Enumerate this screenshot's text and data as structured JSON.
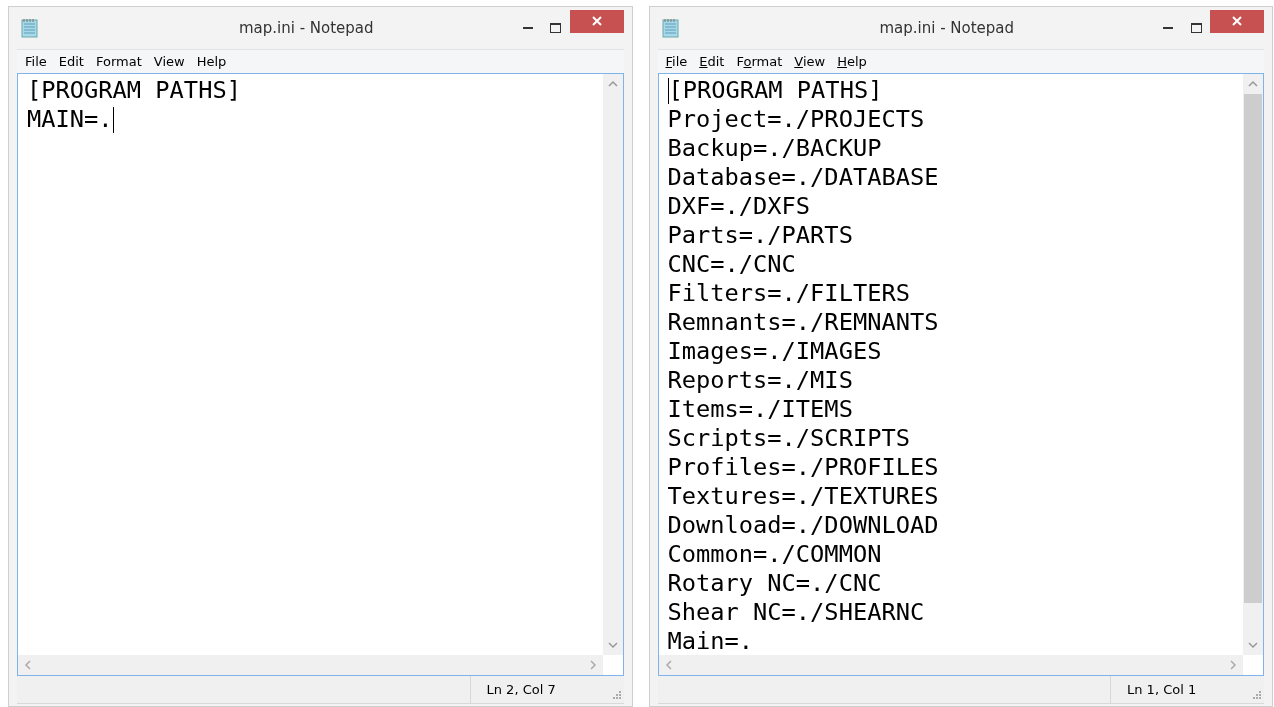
{
  "windows": [
    {
      "title": "map.ini - Notepad",
      "access_keys_shown": false,
      "vertical_thumb": false,
      "menu": [
        {
          "key": "F",
          "tail": "ile"
        },
        {
          "key": "E",
          "tail": "dit"
        },
        {
          "lead": "F",
          "key": "o",
          "tail": "rmat"
        },
        {
          "key": "V",
          "tail": "iew"
        },
        {
          "key": "H",
          "tail": "elp"
        }
      ],
      "lines": [
        {
          "text": "[PROGRAM PATHS]",
          "caret_start": false,
          "caret_end": false
        },
        {
          "text": "MAIN=.",
          "caret_start": false,
          "caret_end": true
        }
      ],
      "status": "Ln 2, Col 7"
    },
    {
      "title": "map.ini - Notepad",
      "access_keys_shown": true,
      "vertical_thumb": true,
      "menu": [
        {
          "key": "F",
          "tail": "ile"
        },
        {
          "key": "E",
          "tail": "dit"
        },
        {
          "lead": "F",
          "key": "o",
          "tail": "rmat"
        },
        {
          "key": "V",
          "tail": "iew"
        },
        {
          "key": "H",
          "tail": "elp"
        }
      ],
      "lines": [
        {
          "text": "[PROGRAM PATHS]",
          "caret_start": true,
          "caret_end": false
        },
        {
          "text": "Project=./PROJECTS",
          "caret_start": false,
          "caret_end": false
        },
        {
          "text": "Backup=./BACKUP",
          "caret_start": false,
          "caret_end": false
        },
        {
          "text": "Database=./DATABASE",
          "caret_start": false,
          "caret_end": false
        },
        {
          "text": "DXF=./DXFS",
          "caret_start": false,
          "caret_end": false
        },
        {
          "text": "Parts=./PARTS",
          "caret_start": false,
          "caret_end": false
        },
        {
          "text": "CNC=./CNC",
          "caret_start": false,
          "caret_end": false
        },
        {
          "text": "Filters=./FILTERS",
          "caret_start": false,
          "caret_end": false
        },
        {
          "text": "Remnants=./REMNANTS",
          "caret_start": false,
          "caret_end": false
        },
        {
          "text": "Images=./IMAGES",
          "caret_start": false,
          "caret_end": false
        },
        {
          "text": "Reports=./MIS",
          "caret_start": false,
          "caret_end": false
        },
        {
          "text": "Items=./ITEMS",
          "caret_start": false,
          "caret_end": false
        },
        {
          "text": "Scripts=./SCRIPTS",
          "caret_start": false,
          "caret_end": false
        },
        {
          "text": "Profiles=./PROFILES",
          "caret_start": false,
          "caret_end": false
        },
        {
          "text": "Textures=./TEXTURES",
          "caret_start": false,
          "caret_end": false
        },
        {
          "text": "Download=./DOWNLOAD",
          "caret_start": false,
          "caret_end": false
        },
        {
          "text": "Common=./COMMON",
          "caret_start": false,
          "caret_end": false
        },
        {
          "text": "Rotary NC=./CNC",
          "caret_start": false,
          "caret_end": false
        },
        {
          "text": "Shear NC=./SHEARNC",
          "caret_start": false,
          "caret_end": false
        },
        {
          "text": "Main=.",
          "caret_start": false,
          "caret_end": false
        }
      ],
      "status": "Ln 1, Col 1"
    }
  ]
}
